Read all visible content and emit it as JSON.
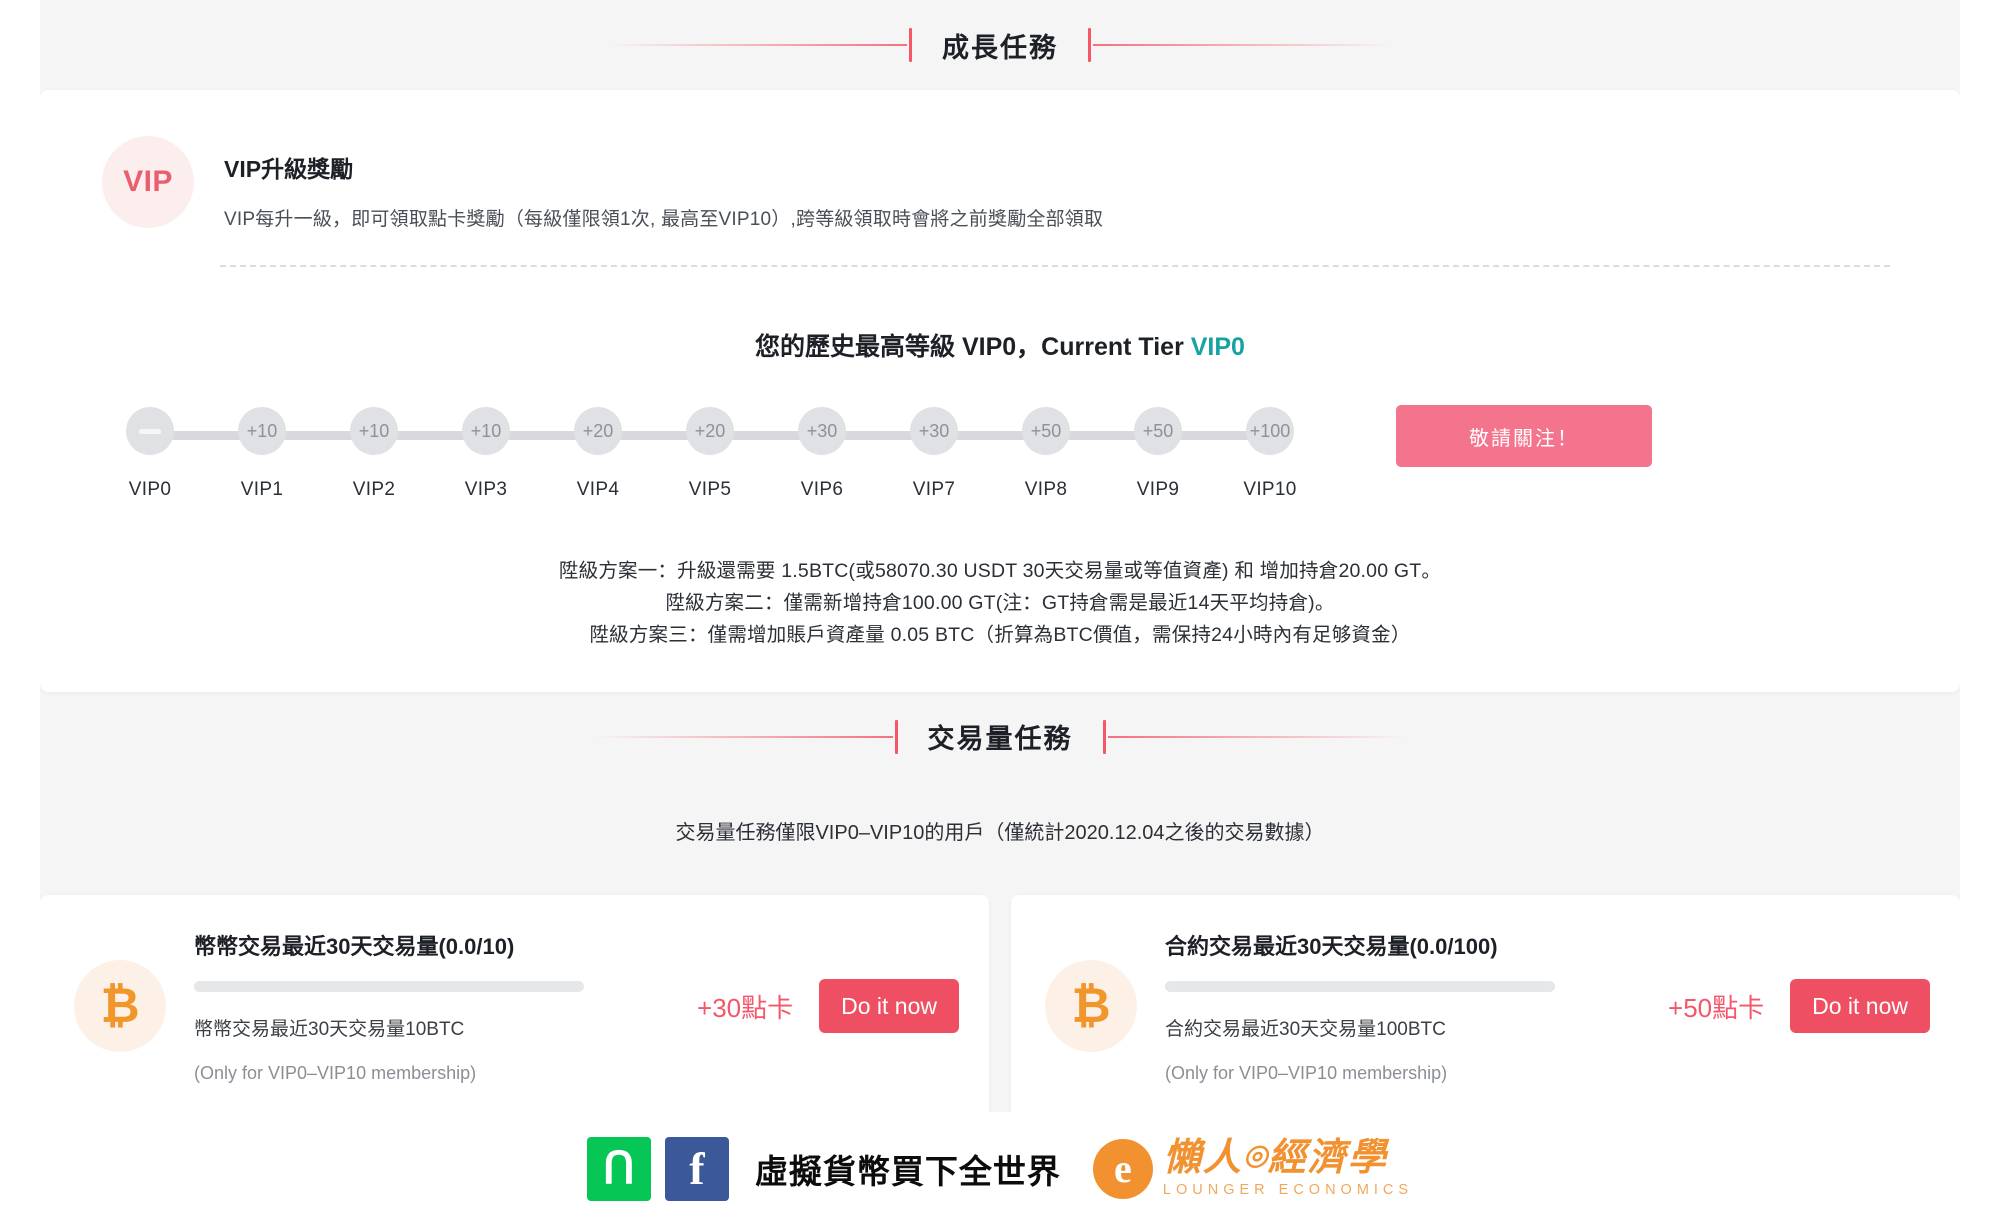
{
  "sections": {
    "growth_title": "成長任務",
    "volume_title": "交易量任務"
  },
  "vip_card": {
    "badge_text": "VIP",
    "title": "VIP升級獎勵",
    "subtitle": "VIP每升一級，即可領取點卡獎勵（每級僅限領1次, 最高至VIP10）,跨等級領取時會將之前獎勵全部領取",
    "tier_prefix": "您的歷史最高等級 VIP0，Current Tier ",
    "tier_current": "VIP0",
    "follow_button": "敬請關注！",
    "accent_color": "#f4566a",
    "current_tier_color": "#17a2a2",
    "steps": [
      {
        "label": "VIP0",
        "value": "—",
        "is_dash": true
      },
      {
        "label": "VIP1",
        "value": "+10",
        "is_dash": false
      },
      {
        "label": "VIP2",
        "value": "+10",
        "is_dash": false
      },
      {
        "label": "VIP3",
        "value": "+10",
        "is_dash": false
      },
      {
        "label": "VIP4",
        "value": "+20",
        "is_dash": false
      },
      {
        "label": "VIP5",
        "value": "+20",
        "is_dash": false
      },
      {
        "label": "VIP6",
        "value": "+30",
        "is_dash": false
      },
      {
        "label": "VIP7",
        "value": "+30",
        "is_dash": false
      },
      {
        "label": "VIP8",
        "value": "+50",
        "is_dash": false
      },
      {
        "label": "VIP9",
        "value": "+50",
        "is_dash": false
      },
      {
        "label": "VIP10",
        "value": "+100",
        "is_dash": false
      }
    ],
    "schemes": [
      "陞級方案一：升級還需要 1.5BTC(或58070.30 USDT 30天交易量或等值資產) 和 增加持倉20.00 GT。",
      "陞級方案二：僅需新增持倉100.00 GT(注：GT持倉需是最近14天平均持倉)。",
      "陞級方案三：僅需增加賬戶資產量 0.05 BTC（折算為BTC價值，需保持24小時內有足够資金）"
    ]
  },
  "volume_section": {
    "note": "交易量任務僅限VIP0–VIP10的用戶（僅統計2020.12.04之後的交易數據）",
    "tasks": [
      {
        "icon": "bitcoin-icon",
        "title": "幣幣交易最近30天交易量(0.0/10)",
        "progress_percent": 0,
        "description": "幣幣交易最近30天交易量10BTC",
        "note": "(Only for VIP0–VIP10 membership)",
        "reward": "+30點卡",
        "button": "Do it now"
      },
      {
        "icon": "bitcoin-icon",
        "title": "合約交易最近30天交易量(0.0/100)",
        "progress_percent": 0,
        "description": "合約交易最近30天交易量100BTC",
        "note": "(Only for VIP0–VIP10 membership)",
        "reward": "+50點卡",
        "button": "Do it now"
      }
    ]
  },
  "footer": {
    "line_glyph": "ᑎ",
    "fb_glyph": "f",
    "slogan": "虛擬貨幣買下全世界",
    "brand_mark": "e",
    "brand_cn": "懶人⌾經濟學",
    "brand_en": "LOUNGER ECONOMICS"
  }
}
